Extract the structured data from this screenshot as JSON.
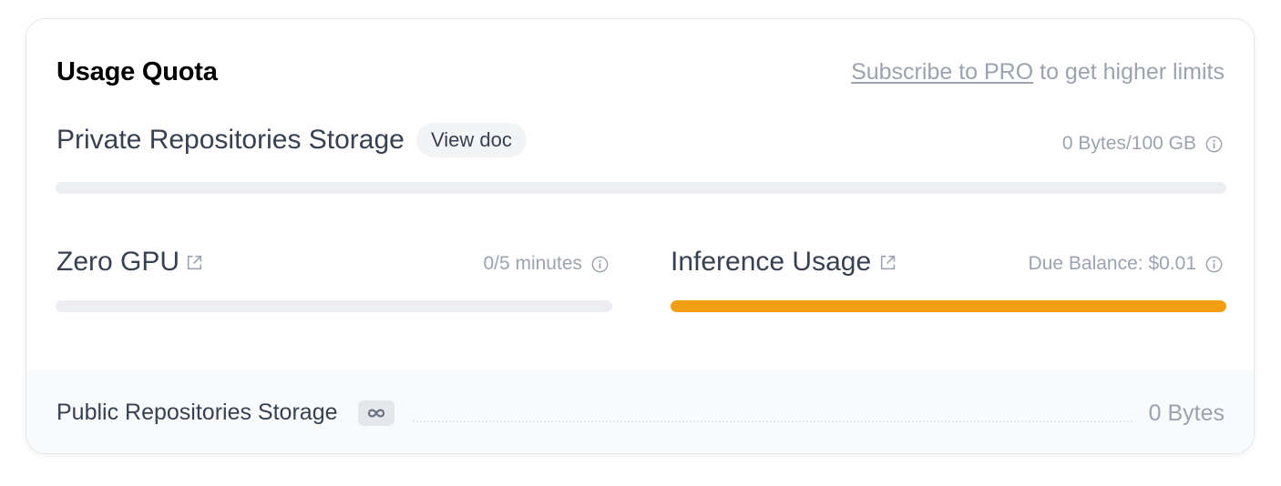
{
  "header": {
    "title": "Usage Quota",
    "promo_link": "Subscribe to PRO",
    "promo_text": " to get higher limits"
  },
  "private_storage": {
    "label": "Private Repositories Storage",
    "doc_button": "View doc",
    "usage": "0 Bytes/100 GB",
    "fill_fraction": 0
  },
  "zero_gpu": {
    "label": "Zero GPU",
    "usage": "0/5 minutes",
    "fill_fraction": 0
  },
  "inference": {
    "label": "Inference Usage",
    "usage": "Due Balance: $0.01",
    "fill_fraction": 1,
    "fill_color": "#f29e12"
  },
  "public_storage": {
    "label": "Public Repositories Storage",
    "badge": "infinity-icon",
    "value": "0 Bytes"
  },
  "icons": {
    "info": "info-icon",
    "external": "external-link-icon"
  }
}
